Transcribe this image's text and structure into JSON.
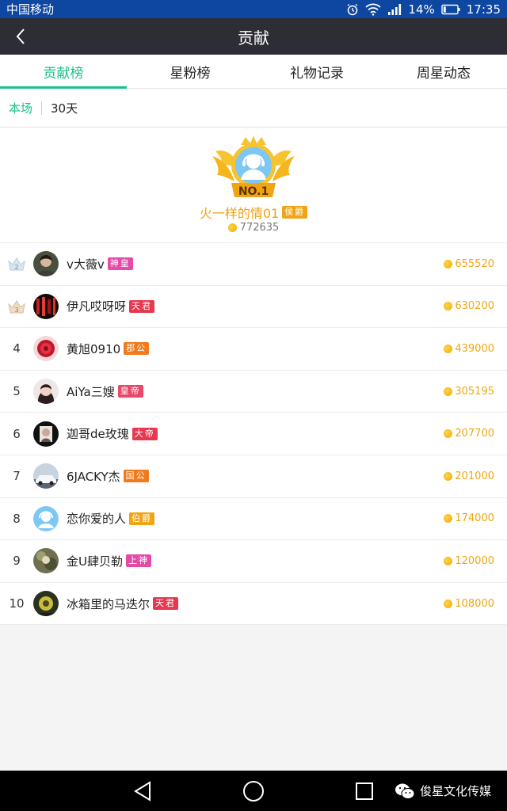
{
  "status_bar": {
    "carrier": "中国移动",
    "battery": "14%",
    "time": "17:35"
  },
  "title_bar": {
    "title": "贡献"
  },
  "tabs": [
    {
      "label": "贡献榜",
      "active": true
    },
    {
      "label": "星粉榜",
      "active": false
    },
    {
      "label": "礼物记录",
      "active": false
    },
    {
      "label": "周星动态",
      "active": false
    }
  ],
  "subtabs": [
    {
      "label": "本场",
      "active": true
    },
    {
      "label": "30天",
      "active": false
    }
  ],
  "top_one": {
    "rank_label": "NO.1",
    "name": "火一样的情01",
    "badge": "侯爵",
    "badge_color": "#f0a313",
    "score": "772635"
  },
  "ranking": [
    {
      "rank": "2",
      "name": "v大薇v",
      "badge": "神皇",
      "badge_color": "#e64aa8",
      "score": "655520"
    },
    {
      "rank": "3",
      "name": "伊凡哎呀呀",
      "badge": "天君",
      "badge_color": "#e8384f",
      "score": "630200"
    },
    {
      "rank": "4",
      "name": "黄旭0910",
      "badge": "郡公",
      "badge_color": "#f07a1c",
      "score": "439000"
    },
    {
      "rank": "5",
      "name": "AiYa三嫂",
      "badge": "皇帝",
      "badge_color": "#e8486a",
      "score": "305195"
    },
    {
      "rank": "6",
      "name": "迦哥de玫瑰",
      "badge": "大帝",
      "badge_color": "#e8384f",
      "score": "207700"
    },
    {
      "rank": "7",
      "name": "6JACKY杰",
      "badge": "国公",
      "badge_color": "#f07a1c",
      "score": "201000"
    },
    {
      "rank": "8",
      "name": "恋你爱的人",
      "badge": "伯爵",
      "badge_color": "#f0a313",
      "score": "174000"
    },
    {
      "rank": "9",
      "name": "金U肆贝勒",
      "badge": "上神",
      "badge_color": "#e64aa8",
      "score": "120000"
    },
    {
      "rank": "10",
      "name": "冰箱里的马迭尔",
      "badge": "天君",
      "badge_color": "#e8384f",
      "score": "108000"
    }
  ],
  "watermark": {
    "text": "俊星文化传媒"
  },
  "colors": {
    "accent": "#17c28a",
    "score": "#f2a610"
  }
}
